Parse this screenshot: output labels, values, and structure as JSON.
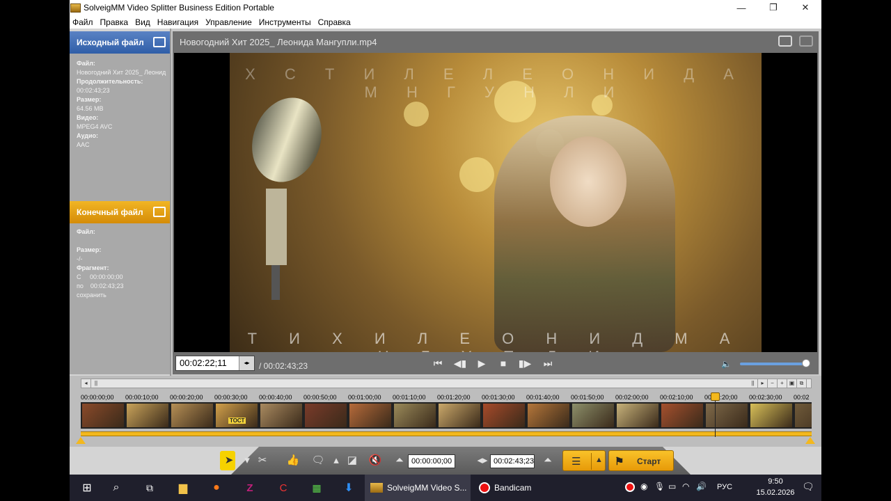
{
  "window": {
    "title": "SolveigMM Video Splitter Business Edition Portable",
    "controls": {
      "minimize": "—",
      "maximize": "❐",
      "close": "✕"
    }
  },
  "menu": [
    "Файл",
    "Правка",
    "Вид",
    "Навигация",
    "Управление",
    "Инструменты",
    "Справка"
  ],
  "source_panel": {
    "title": "Исходный файл",
    "file_label": "Файл:",
    "file_value": "Новогодний Хит 2025_ Леонид",
    "duration_label": "Продолжительность:",
    "duration_value": "00:02:43;23",
    "size_label": "Размер:",
    "size_value": "64.56 MB",
    "video_label": "Видео:",
    "video_value": "MPEG4 AVC",
    "audio_label": "Аудио:",
    "audio_value": "AAC"
  },
  "dest_panel": {
    "title": "Конечный файл",
    "file_label": "Файл:",
    "size_label": "Размер:",
    "size_value": "-/-",
    "fragment_label": "Фрагмент:",
    "from_label": "С",
    "from_value": "00:00:00;00",
    "to_label": "по",
    "to_value": "00:02:43;23",
    "save_label": "сохранить"
  },
  "video": {
    "filename": "Новогодний Хит 2025_ Леонида Мангупли.mp4",
    "overlay_top": "Х  С Т И Л  Е Л Е О Н И Д  А М Н Г У Н Л И",
    "overlay_bottom": "Т И Х И  Л Е О Н И Д   М А Н Г У П Л И",
    "thumb_text": "ТОСТ"
  },
  "player": {
    "current_time": "00:02:22;11",
    "total_time": "/ 00:02:43;23",
    "volume_fraction": 0.95
  },
  "timeline": {
    "ticks": [
      "00:00:00;00",
      "00:00:10;00",
      "00:00:20;00",
      "00:00:30;00",
      "00:00:40;00",
      "00:00:50;00",
      "00:01:00;00",
      "00:01:10;00",
      "00:01:20;00",
      "00:01:30;00",
      "00:01:40;00",
      "00:01:50;00",
      "00:02:00;00",
      "00:02:10;00",
      "00:02:20;00",
      "00:02:30;00",
      "00:02"
    ],
    "playhead_position": "00:02:22;11"
  },
  "toolbar": {
    "start_time": "00:00:00;00",
    "end_time": "00:02:43;23",
    "start_button": "Старт"
  },
  "taskbar": {
    "app1": "SolveigMM Video S...",
    "app2": "Bandicam",
    "lang": "РУС",
    "time": "9:50",
    "date": "15.02.2026"
  },
  "colors": {
    "source_header": "#2f5ea8",
    "dest_header": "#e79a08",
    "accent_yellow": "#f3b81d"
  }
}
